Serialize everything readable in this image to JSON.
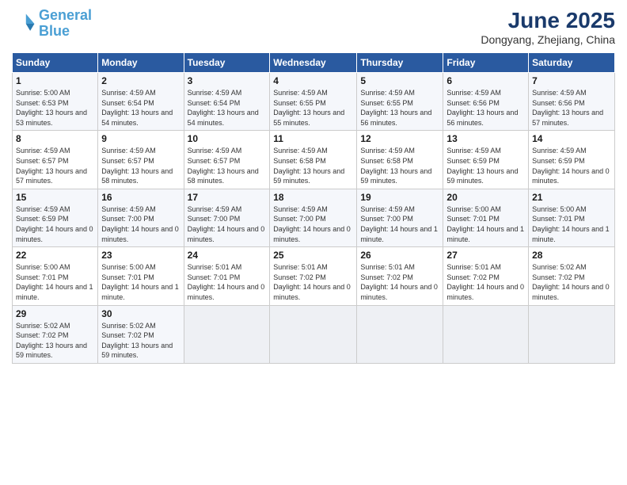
{
  "header": {
    "logo_line1": "General",
    "logo_line2": "Blue",
    "month_year": "June 2025",
    "location": "Dongyang, Zhejiang, China"
  },
  "weekdays": [
    "Sunday",
    "Monday",
    "Tuesday",
    "Wednesday",
    "Thursday",
    "Friday",
    "Saturday"
  ],
  "weeks": [
    [
      {
        "day": "1",
        "sunrise": "Sunrise: 5:00 AM",
        "sunset": "Sunset: 6:53 PM",
        "daylight": "Daylight: 13 hours and 53 minutes."
      },
      {
        "day": "2",
        "sunrise": "Sunrise: 4:59 AM",
        "sunset": "Sunset: 6:54 PM",
        "daylight": "Daylight: 13 hours and 54 minutes."
      },
      {
        "day": "3",
        "sunrise": "Sunrise: 4:59 AM",
        "sunset": "Sunset: 6:54 PM",
        "daylight": "Daylight: 13 hours and 54 minutes."
      },
      {
        "day": "4",
        "sunrise": "Sunrise: 4:59 AM",
        "sunset": "Sunset: 6:55 PM",
        "daylight": "Daylight: 13 hours and 55 minutes."
      },
      {
        "day": "5",
        "sunrise": "Sunrise: 4:59 AM",
        "sunset": "Sunset: 6:55 PM",
        "daylight": "Daylight: 13 hours and 56 minutes."
      },
      {
        "day": "6",
        "sunrise": "Sunrise: 4:59 AM",
        "sunset": "Sunset: 6:56 PM",
        "daylight": "Daylight: 13 hours and 56 minutes."
      },
      {
        "day": "7",
        "sunrise": "Sunrise: 4:59 AM",
        "sunset": "Sunset: 6:56 PM",
        "daylight": "Daylight: 13 hours and 57 minutes."
      }
    ],
    [
      {
        "day": "8",
        "sunrise": "Sunrise: 4:59 AM",
        "sunset": "Sunset: 6:57 PM",
        "daylight": "Daylight: 13 hours and 57 minutes."
      },
      {
        "day": "9",
        "sunrise": "Sunrise: 4:59 AM",
        "sunset": "Sunset: 6:57 PM",
        "daylight": "Daylight: 13 hours and 58 minutes."
      },
      {
        "day": "10",
        "sunrise": "Sunrise: 4:59 AM",
        "sunset": "Sunset: 6:57 PM",
        "daylight": "Daylight: 13 hours and 58 minutes."
      },
      {
        "day": "11",
        "sunrise": "Sunrise: 4:59 AM",
        "sunset": "Sunset: 6:58 PM",
        "daylight": "Daylight: 13 hours and 59 minutes."
      },
      {
        "day": "12",
        "sunrise": "Sunrise: 4:59 AM",
        "sunset": "Sunset: 6:58 PM",
        "daylight": "Daylight: 13 hours and 59 minutes."
      },
      {
        "day": "13",
        "sunrise": "Sunrise: 4:59 AM",
        "sunset": "Sunset: 6:59 PM",
        "daylight": "Daylight: 13 hours and 59 minutes."
      },
      {
        "day": "14",
        "sunrise": "Sunrise: 4:59 AM",
        "sunset": "Sunset: 6:59 PM",
        "daylight": "Daylight: 14 hours and 0 minutes."
      }
    ],
    [
      {
        "day": "15",
        "sunrise": "Sunrise: 4:59 AM",
        "sunset": "Sunset: 6:59 PM",
        "daylight": "Daylight: 14 hours and 0 minutes."
      },
      {
        "day": "16",
        "sunrise": "Sunrise: 4:59 AM",
        "sunset": "Sunset: 7:00 PM",
        "daylight": "Daylight: 14 hours and 0 minutes."
      },
      {
        "day": "17",
        "sunrise": "Sunrise: 4:59 AM",
        "sunset": "Sunset: 7:00 PM",
        "daylight": "Daylight: 14 hours and 0 minutes."
      },
      {
        "day": "18",
        "sunrise": "Sunrise: 4:59 AM",
        "sunset": "Sunset: 7:00 PM",
        "daylight": "Daylight: 14 hours and 0 minutes."
      },
      {
        "day": "19",
        "sunrise": "Sunrise: 4:59 AM",
        "sunset": "Sunset: 7:00 PM",
        "daylight": "Daylight: 14 hours and 1 minute."
      },
      {
        "day": "20",
        "sunrise": "Sunrise: 5:00 AM",
        "sunset": "Sunset: 7:01 PM",
        "daylight": "Daylight: 14 hours and 1 minute."
      },
      {
        "day": "21",
        "sunrise": "Sunrise: 5:00 AM",
        "sunset": "Sunset: 7:01 PM",
        "daylight": "Daylight: 14 hours and 1 minute."
      }
    ],
    [
      {
        "day": "22",
        "sunrise": "Sunrise: 5:00 AM",
        "sunset": "Sunset: 7:01 PM",
        "daylight": "Daylight: 14 hours and 1 minute."
      },
      {
        "day": "23",
        "sunrise": "Sunrise: 5:00 AM",
        "sunset": "Sunset: 7:01 PM",
        "daylight": "Daylight: 14 hours and 1 minute."
      },
      {
        "day": "24",
        "sunrise": "Sunrise: 5:01 AM",
        "sunset": "Sunset: 7:01 PM",
        "daylight": "Daylight: 14 hours and 0 minutes."
      },
      {
        "day": "25",
        "sunrise": "Sunrise: 5:01 AM",
        "sunset": "Sunset: 7:02 PM",
        "daylight": "Daylight: 14 hours and 0 minutes."
      },
      {
        "day": "26",
        "sunrise": "Sunrise: 5:01 AM",
        "sunset": "Sunset: 7:02 PM",
        "daylight": "Daylight: 14 hours and 0 minutes."
      },
      {
        "day": "27",
        "sunrise": "Sunrise: 5:01 AM",
        "sunset": "Sunset: 7:02 PM",
        "daylight": "Daylight: 14 hours and 0 minutes."
      },
      {
        "day": "28",
        "sunrise": "Sunrise: 5:02 AM",
        "sunset": "Sunset: 7:02 PM",
        "daylight": "Daylight: 14 hours and 0 minutes."
      }
    ],
    [
      {
        "day": "29",
        "sunrise": "Sunrise: 5:02 AM",
        "sunset": "Sunset: 7:02 PM",
        "daylight": "Daylight: 13 hours and 59 minutes."
      },
      {
        "day": "30",
        "sunrise": "Sunrise: 5:02 AM",
        "sunset": "Sunset: 7:02 PM",
        "daylight": "Daylight: 13 hours and 59 minutes."
      },
      null,
      null,
      null,
      null,
      null
    ]
  ]
}
